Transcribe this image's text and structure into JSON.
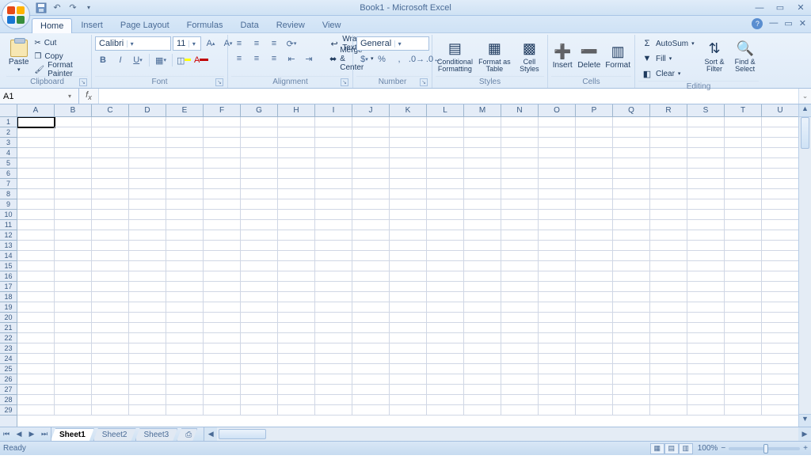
{
  "title": "Book1 - Microsoft Excel",
  "qat": {
    "save": "save",
    "undo": "undo",
    "redo": "redo"
  },
  "tabs": [
    "Home",
    "Insert",
    "Page Layout",
    "Formulas",
    "Data",
    "Review",
    "View"
  ],
  "active_tab": "Home",
  "ribbon": {
    "clipboard": {
      "label": "Clipboard",
      "paste": "Paste",
      "cut": "Cut",
      "copy": "Copy",
      "format_painter": "Format Painter"
    },
    "font": {
      "label": "Font",
      "font_name": "Calibri",
      "font_size": "11"
    },
    "alignment": {
      "label": "Alignment",
      "wrap": "Wrap Text",
      "merge": "Merge & Center"
    },
    "number": {
      "label": "Number",
      "format": "General"
    },
    "styles": {
      "label": "Styles",
      "conditional": "Conditional Formatting",
      "table": "Format as Table",
      "cell": "Cell Styles"
    },
    "cells": {
      "label": "Cells",
      "insert": "Insert",
      "delete": "Delete",
      "format": "Format"
    },
    "editing": {
      "label": "Editing",
      "autosum": "AutoSum",
      "fill": "Fill",
      "clear": "Clear",
      "sort": "Sort & Filter",
      "find": "Find & Select"
    }
  },
  "formula_bar": {
    "cell_ref": "A1",
    "formula": ""
  },
  "grid": {
    "columns": [
      "A",
      "B",
      "C",
      "D",
      "E",
      "F",
      "G",
      "H",
      "I",
      "J",
      "K",
      "L",
      "M",
      "N",
      "O",
      "P",
      "Q",
      "R",
      "S",
      "T",
      "U"
    ],
    "row_count": 29
  },
  "sheets": {
    "tabs": [
      "Sheet1",
      "Sheet2",
      "Sheet3"
    ],
    "active": "Sheet1"
  },
  "status": {
    "text": "Ready",
    "zoom": "100%"
  }
}
